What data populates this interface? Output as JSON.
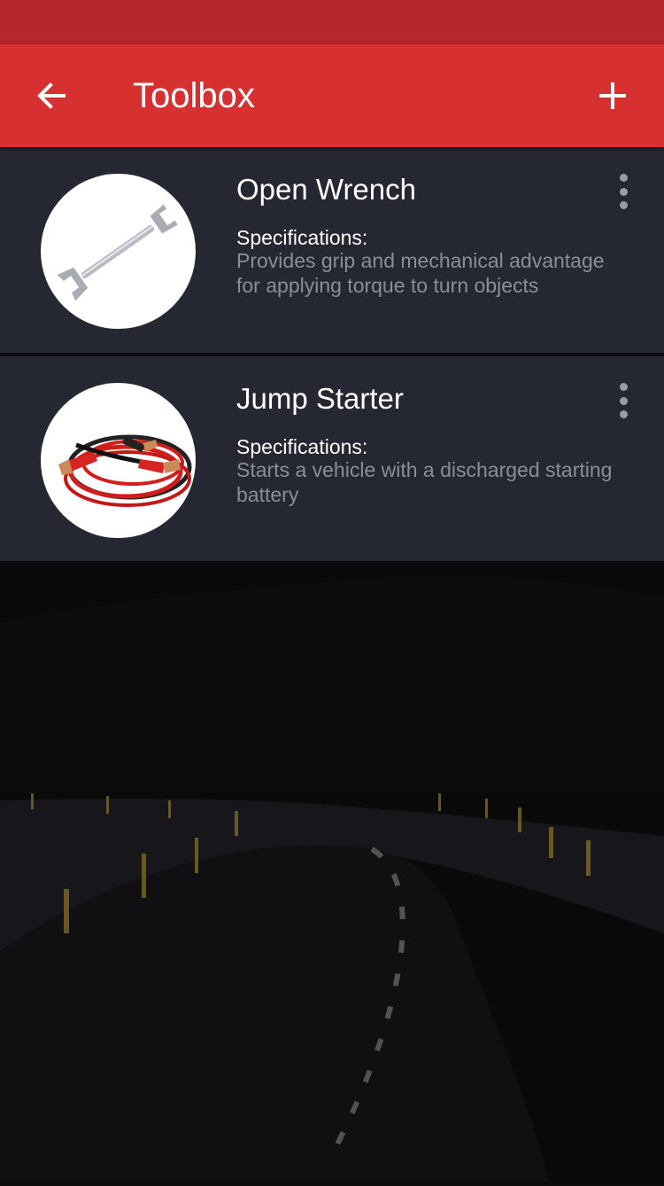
{
  "app": {
    "title": "Toolbox"
  },
  "colors": {
    "accent": "#d63031",
    "status_bar": "#b3272b",
    "card": "#252733"
  },
  "icons": {
    "back": "arrow-left-icon",
    "add": "plus-icon",
    "more": "more-vert-icon"
  },
  "items": [
    {
      "name": "Open Wrench",
      "spec_label": "Specifications:",
      "spec_text": "Provides grip and mechanical advantage for applying torque to turn objects",
      "image": "wrench-image"
    },
    {
      "name": "Jump Starter",
      "spec_label": "Specifications:",
      "spec_text": "Starts a vehicle with a discharged starting battery",
      "image": "jumper-cables-image"
    }
  ]
}
